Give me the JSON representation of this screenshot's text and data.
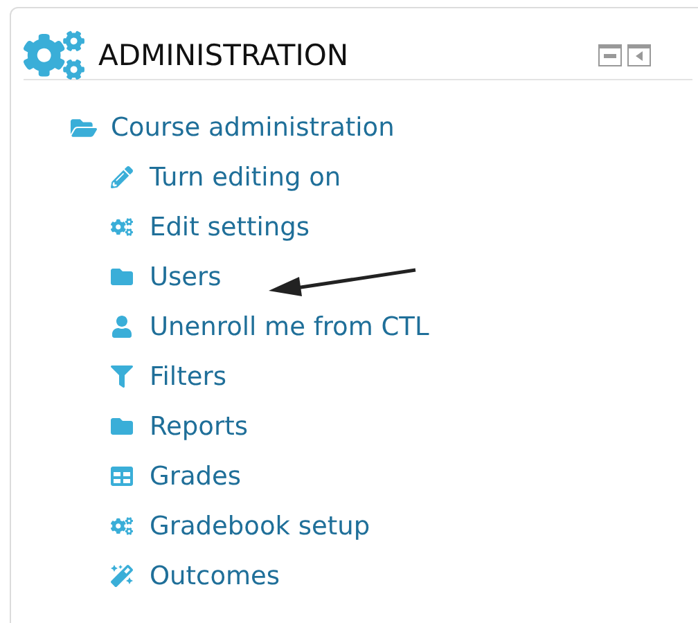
{
  "block": {
    "title": "ADMINISTRATION"
  },
  "tree": {
    "label": "Course administration",
    "expanded": true,
    "children": [
      {
        "label": "Turn editing on",
        "kind": "pencil"
      },
      {
        "label": "Edit settings",
        "kind": "gears"
      },
      {
        "label": "Users",
        "kind": "folder"
      },
      {
        "label": "Unenroll me from CTL",
        "kind": "user"
      },
      {
        "label": "Filters",
        "kind": "filter"
      },
      {
        "label": "Reports",
        "kind": "folder"
      },
      {
        "label": "Grades",
        "kind": "table"
      },
      {
        "label": "Gradebook setup",
        "kind": "gears"
      },
      {
        "label": "Outcomes",
        "kind": "wand"
      }
    ]
  }
}
